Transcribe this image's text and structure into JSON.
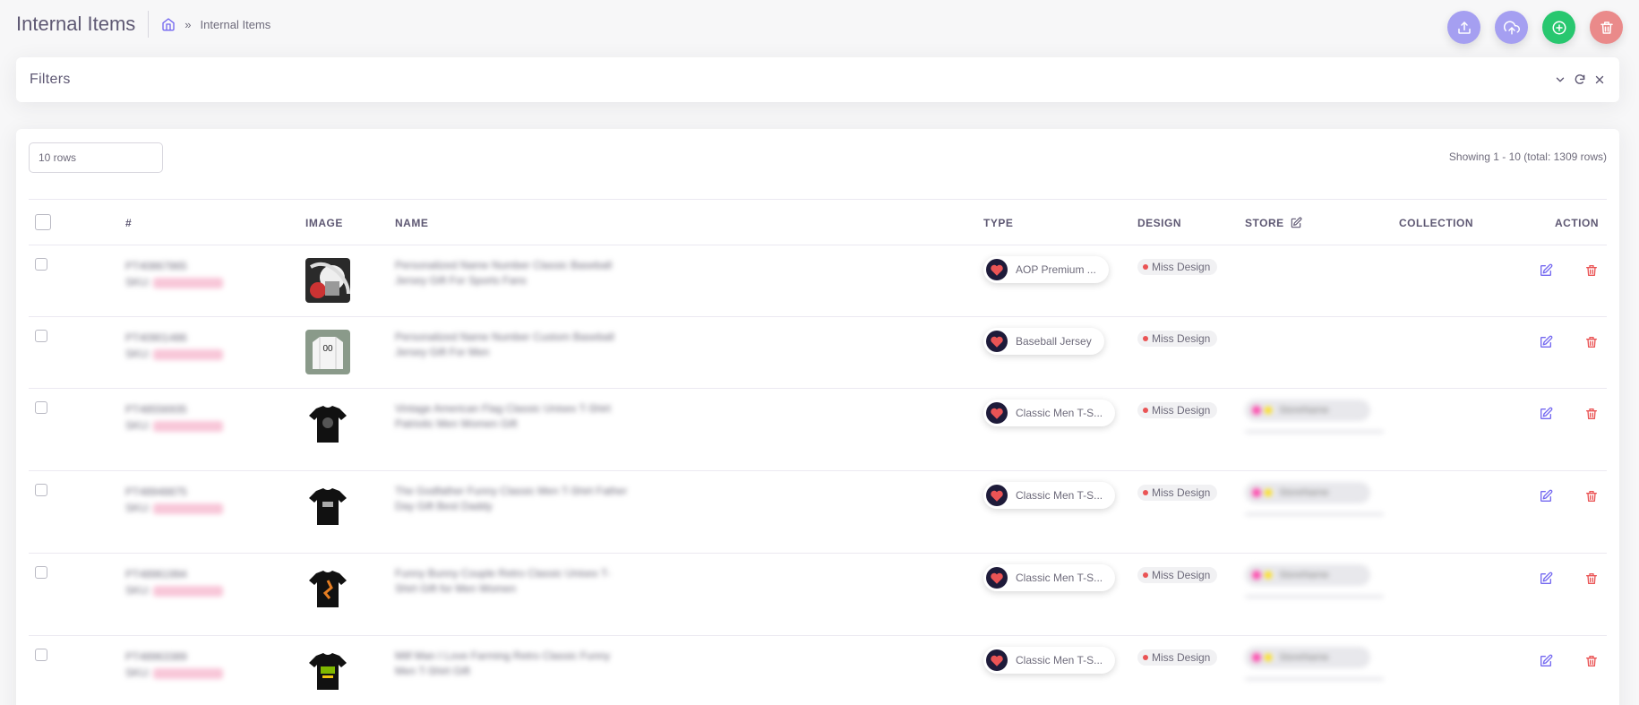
{
  "header": {
    "title": "Internal Items",
    "breadcrumb_current": "Internal Items",
    "breadcrumb_sep": "»"
  },
  "colors": {
    "export": "#a59ff1",
    "upload": "#a59ff1",
    "add": "#28c76f",
    "delete": "#ea8a8a",
    "accent": "#7367f0",
    "danger": "#ea5455"
  },
  "filters": {
    "title": "Filters"
  },
  "table": {
    "rows_select": "10 rows",
    "showing": "Showing 1 - 10 (total: 1309 rows)",
    "columns": {
      "num": "#",
      "image": "IMAGE",
      "name": "NAME",
      "type": "TYPE",
      "design": "DESIGN",
      "store": "STORE",
      "collection": "COLLECTION",
      "action": "ACTION"
    },
    "rows": [
      {
        "id": "PT40867865",
        "sku": "SKU:",
        "name": "Personalized Name Number Classic Baseball Jersey Gift For Sports Fans",
        "type": "AOP Premium ...",
        "design": "Miss Design",
        "store": "",
        "image_kind": "abstract"
      },
      {
        "id": "PT40901486",
        "sku": "SKU:",
        "name": "Personalized Name Number Custom Baseball Jersey Gift For Men",
        "type": "Baseball Jersey",
        "design": "Miss Design",
        "store": "",
        "image_kind": "jersey"
      },
      {
        "id": "PT48556935",
        "sku": "SKU:",
        "name": "Vintage American Flag Classic Unisex T-Shirt Patriotic Men Women Gift",
        "type": "Classic Men T-S...",
        "design": "Miss Design",
        "store": "StoreName",
        "image_kind": "tee1"
      },
      {
        "id": "PT48948875",
        "sku": "SKU:",
        "name": "The Godfather Funny Classic Men T-Shirt Father Day Gift Best Daddy",
        "type": "Classic Men T-S...",
        "design": "Miss Design",
        "store": "StoreName",
        "image_kind": "tee2"
      },
      {
        "id": "PT48961994",
        "sku": "SKU:",
        "name": "Funny Bunny Couple Retro Classic Unisex T-Shirt Gift for Men Women",
        "type": "Classic Men T-S...",
        "design": "Miss Design",
        "store": "StoreName",
        "image_kind": "tee3"
      },
      {
        "id": "PT48963389",
        "sku": "SKU:",
        "name": "Milf Man I Love Farming Retro Classic Funny Men T-Shirt Gift",
        "type": "Classic Men T-S...",
        "design": "Miss Design",
        "store": "StoreName",
        "image_kind": "tee4"
      }
    ]
  }
}
